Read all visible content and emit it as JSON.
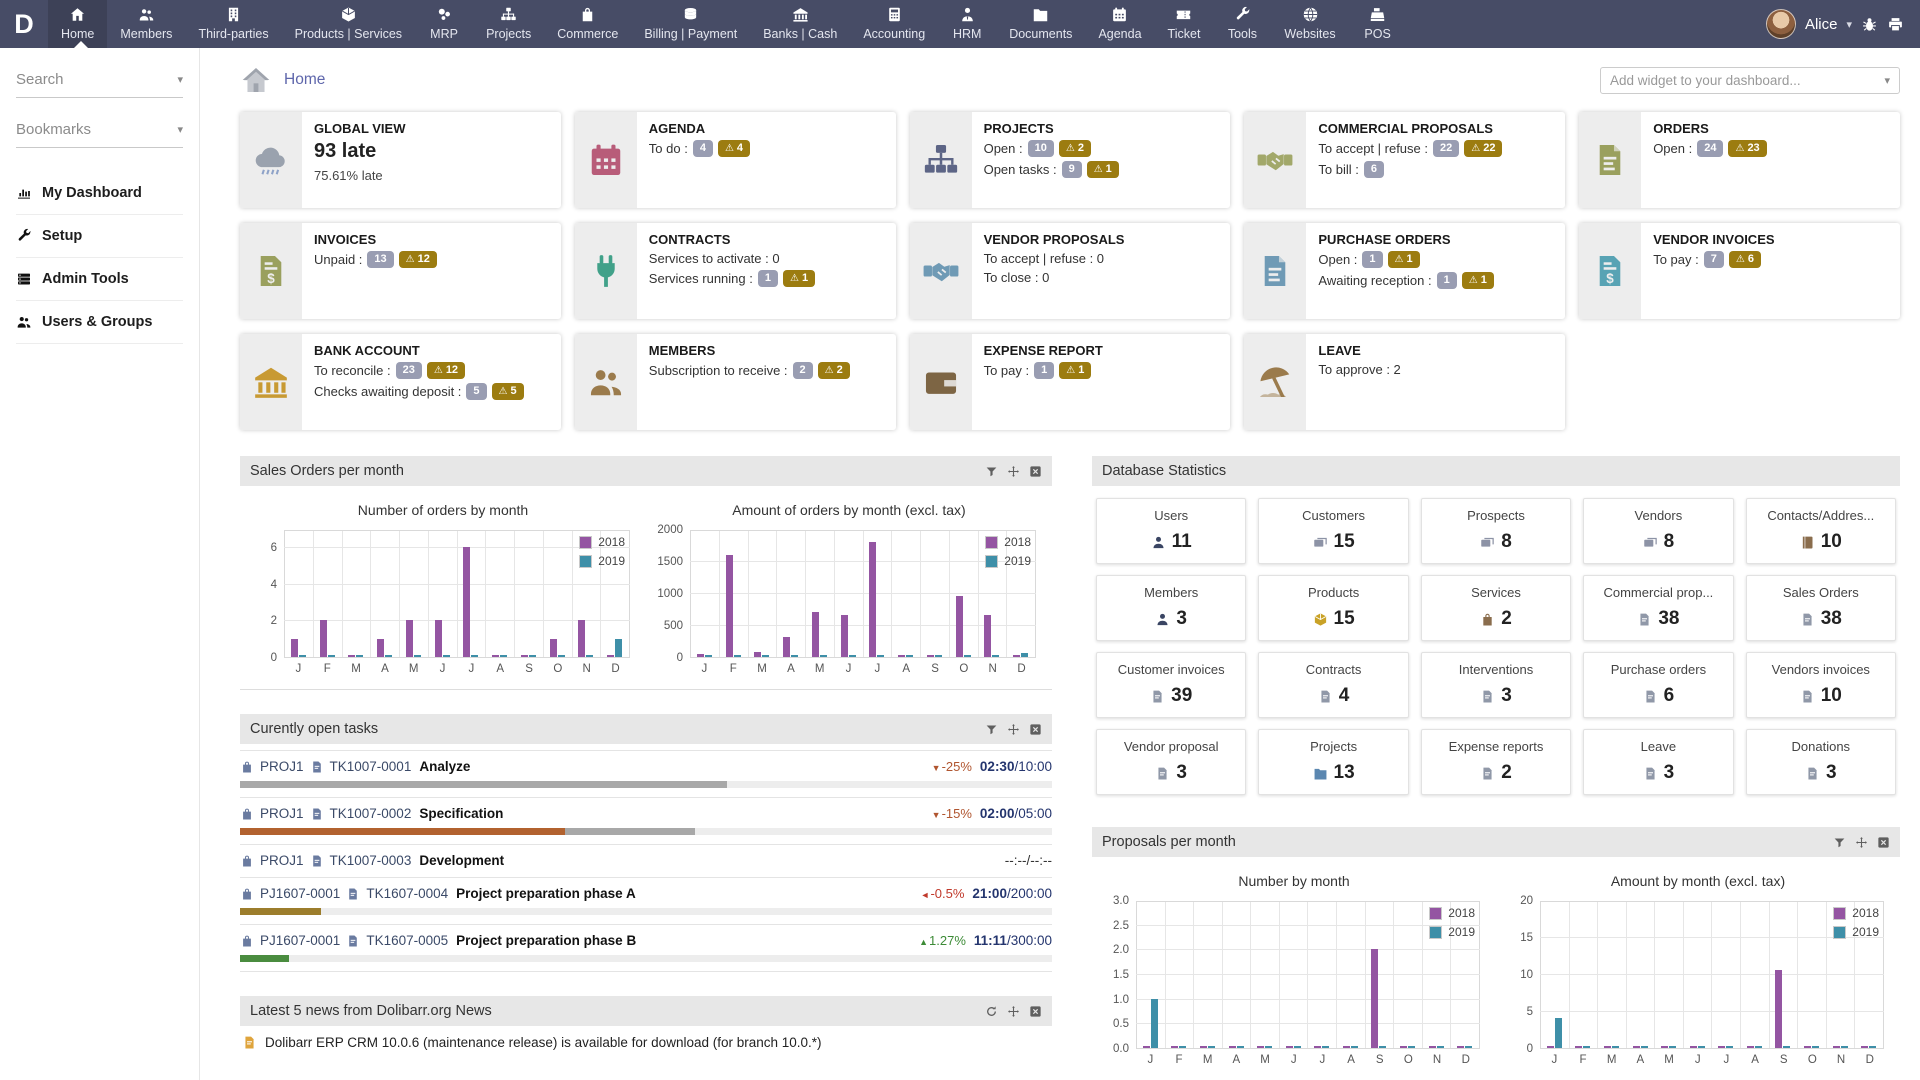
{
  "app": {
    "logo_letter": "D"
  },
  "theme": {
    "nav_bg": "#474c66",
    "badge_gray": "#999db2",
    "badge_warn": "#9c7c10",
    "link": "#5e66ab",
    "bar_2018": "#9455a2",
    "bar_2019": "#3e8fa8"
  },
  "nav": {
    "user_name": "Alice",
    "items": [
      {
        "label": "Home",
        "icon": "home-icon",
        "active": true
      },
      {
        "label": "Members",
        "icon": "members-icon"
      },
      {
        "label": "Third-parties",
        "icon": "third-parties-icon"
      },
      {
        "label": "Products | Services",
        "icon": "products-icon"
      },
      {
        "label": "MRP",
        "icon": "mrp-icon"
      },
      {
        "label": "Projects",
        "icon": "projects-icon"
      },
      {
        "label": "Commerce",
        "icon": "commerce-icon"
      },
      {
        "label": "Billing | Payment",
        "icon": "billing-icon"
      },
      {
        "label": "Banks | Cash",
        "icon": "banks-icon"
      },
      {
        "label": "Accounting",
        "icon": "accounting-icon"
      },
      {
        "label": "HRM",
        "icon": "hrm-icon"
      },
      {
        "label": "Documents",
        "icon": "documents-icon"
      },
      {
        "label": "Agenda",
        "icon": "agenda-icon"
      },
      {
        "label": "Ticket",
        "icon": "ticket-icon"
      },
      {
        "label": "Tools",
        "icon": "tools-icon"
      },
      {
        "label": "Websites",
        "icon": "websites-icon"
      },
      {
        "label": "POS",
        "icon": "pos-icon"
      }
    ]
  },
  "sidebar": {
    "search_label": "Search",
    "bookmarks_label": "Bookmarks",
    "items": [
      {
        "label": "My Dashboard",
        "icon": "dashboard-icon"
      },
      {
        "label": "Setup",
        "icon": "setup-icon"
      },
      {
        "label": "Admin Tools",
        "icon": "admin-tools-icon"
      },
      {
        "label": "Users & Groups",
        "icon": "users-groups-icon"
      }
    ]
  },
  "header": {
    "breadcrumb": "Home",
    "add_widget_placeholder": "Add widget to your dashboard..."
  },
  "widgets": [
    {
      "title": "GLOBAL VIEW",
      "icon": "storm-icon",
      "icon_color": "#97a0ad",
      "big": "93 late",
      "sub": "75.61% late",
      "lines": []
    },
    {
      "title": "AGENDA",
      "icon": "agenda-icon",
      "icon_color": "#b85c79",
      "lines": [
        {
          "label": "To do :",
          "badges": [
            {
              "v": "4"
            },
            {
              "v": "4",
              "warn": true
            }
          ]
        }
      ]
    },
    {
      "title": "PROJECTS",
      "icon": "projects-icon",
      "icon_color": "#5d6586",
      "lines": [
        {
          "label": "Open :",
          "badges": [
            {
              "v": "10"
            },
            {
              "v": "2",
              "warn": true
            }
          ]
        },
        {
          "label": "Open tasks :",
          "badges": [
            {
              "v": "9"
            },
            {
              "v": "1",
              "warn": true
            }
          ]
        }
      ]
    },
    {
      "title": "COMMERCIAL PROPOSALS",
      "icon": "handshake-icon",
      "icon_color": "#a2a86a",
      "lines": [
        {
          "label": "To accept | refuse :",
          "badges": [
            {
              "v": "22"
            },
            {
              "v": "22",
              "warn": true
            }
          ]
        },
        {
          "label": "To bill :",
          "badges": [
            {
              "v": "6"
            }
          ]
        }
      ]
    },
    {
      "title": "ORDERS",
      "icon": "order-doc-icon",
      "icon_color": "#9aa05e",
      "lines": [
        {
          "label": "Open :",
          "badges": [
            {
              "v": "24"
            },
            {
              "v": "23",
              "warn": true
            }
          ]
        }
      ]
    },
    {
      "title": "INVOICES",
      "icon": "invoice-dollar-icon",
      "icon_color": "#9aa05e",
      "lines": [
        {
          "label": "Unpaid :",
          "badges": [
            {
              "v": "13"
            },
            {
              "v": "12",
              "warn": true
            }
          ]
        }
      ]
    },
    {
      "title": "CONTRACTS",
      "icon": "plug-icon",
      "icon_color": "#41a189",
      "lines": [
        {
          "label": "Services to activate : 0",
          "badges": []
        },
        {
          "label": "Services running :",
          "badges": [
            {
              "v": "1"
            },
            {
              "v": "1",
              "warn": true
            }
          ]
        }
      ]
    },
    {
      "title": "VENDOR PROPOSALS",
      "icon": "handshake-icon",
      "icon_color": "#6f9ab5",
      "lines": [
        {
          "label": "To accept | refuse : 0",
          "badges": []
        },
        {
          "label": "To close : 0",
          "badges": []
        }
      ]
    },
    {
      "title": "PURCHASE ORDERS",
      "icon": "purchase-doc-icon",
      "icon_color": "#6f9ab5",
      "lines": [
        {
          "label": "Open :",
          "badges": [
            {
              "v": "1"
            },
            {
              "v": "1",
              "warn": true
            }
          ]
        },
        {
          "label": "Awaiting reception :",
          "badges": [
            {
              "v": "1"
            },
            {
              "v": "1",
              "warn": true
            }
          ]
        }
      ]
    },
    {
      "title": "VENDOR INVOICES",
      "icon": "invoice-dollar-icon",
      "icon_color": "#58a3b4",
      "lines": [
        {
          "label": "To pay :",
          "badges": [
            {
              "v": "7"
            },
            {
              "v": "6",
              "warn": true
            }
          ]
        }
      ]
    },
    {
      "title": "BANK ACCOUNT",
      "icon": "bank-icon",
      "icon_color": "#c89a33",
      "lines": [
        {
          "label": "To reconcile :",
          "badges": [
            {
              "v": "23"
            },
            {
              "v": "12",
              "warn": true
            }
          ]
        },
        {
          "label": "Checks awaiting deposit :",
          "badges": [
            {
              "v": "5"
            },
            {
              "v": "5",
              "warn": true
            }
          ]
        }
      ]
    },
    {
      "title": "MEMBERS",
      "icon": "members-group-icon",
      "icon_color": "#9b7b4c",
      "lines": [
        {
          "label": "Subscription to receive :",
          "badges": [
            {
              "v": "2"
            },
            {
              "v": "2",
              "warn": true
            }
          ]
        }
      ]
    },
    {
      "title": "EXPENSE REPORT",
      "icon": "wallet-icon",
      "icon_color": "#7d6544",
      "lines": [
        {
          "label": "To pay :",
          "badges": [
            {
              "v": "1"
            },
            {
              "v": "1",
              "warn": true
            }
          ]
        }
      ]
    },
    {
      "title": "LEAVE",
      "icon": "umbrella-icon",
      "icon_color": "#9b7b4c",
      "lines": [
        {
          "label": "To approve : 2",
          "badges": []
        }
      ]
    }
  ],
  "sections": {
    "sales": {
      "title": "Sales Orders per month"
    },
    "tasks": {
      "title": "Curently open tasks"
    },
    "news": {
      "title": "Latest 5 news from Dolibarr.org News"
    },
    "stats": {
      "title": "Database Statistics"
    },
    "proposals": {
      "title": "Proposals per month"
    }
  },
  "chart_data": [
    {
      "id": "sales-number",
      "type": "bar",
      "title": "Number of orders by month",
      "categories": [
        "J",
        "F",
        "M",
        "A",
        "M",
        "J",
        "J",
        "A",
        "S",
        "O",
        "N",
        "D"
      ],
      "ylim": [
        0,
        7
      ],
      "ymax": 7,
      "grid": true,
      "legend_position": "top-right",
      "yticks": [
        {
          "v": 0,
          "label": "0"
        },
        {
          "v": 2,
          "label": "2"
        },
        {
          "v": 4,
          "label": "4"
        },
        {
          "v": 6,
          "label": "6"
        }
      ],
      "series": [
        {
          "name": "2018",
          "color": "#9455a2",
          "values": [
            1,
            2,
            0,
            1,
            2,
            2,
            6,
            0,
            0,
            1,
            2,
            0
          ]
        },
        {
          "name": "2019",
          "color": "#3e8fa8",
          "values": [
            0,
            0,
            0,
            0,
            0,
            0,
            0,
            0,
            0,
            0,
            0,
            1
          ]
        }
      ]
    },
    {
      "id": "sales-amount",
      "type": "bar",
      "title": "Amount of orders by month (excl. tax)",
      "categories": [
        "J",
        "F",
        "M",
        "A",
        "M",
        "J",
        "J",
        "A",
        "S",
        "O",
        "N",
        "D"
      ],
      "ylim": [
        0,
        2000
      ],
      "ymax": 2000,
      "grid": true,
      "legend_position": "top-right",
      "yticks": [
        {
          "v": 0,
          "label": "0"
        },
        {
          "v": 500,
          "label": "500"
        },
        {
          "v": 1000,
          "label": "1000"
        },
        {
          "v": 1500,
          "label": "1500"
        },
        {
          "v": 2000,
          "label": "2000"
        }
      ],
      "series": [
        {
          "name": "2018",
          "color": "#9455a2",
          "values": [
            50,
            1600,
            80,
            320,
            700,
            650,
            1800,
            30,
            30,
            950,
            650,
            30
          ]
        },
        {
          "name": "2019",
          "color": "#3e8fa8",
          "values": [
            0,
            0,
            0,
            0,
            0,
            0,
            0,
            0,
            0,
            0,
            0,
            60
          ]
        }
      ]
    },
    {
      "id": "proposals-number",
      "type": "bar",
      "title": "Number by month",
      "categories": [
        "J",
        "F",
        "M",
        "A",
        "M",
        "J",
        "J",
        "A",
        "S",
        "O",
        "N",
        "D"
      ],
      "ylim": [
        0,
        3
      ],
      "ymax": 3,
      "grid": true,
      "legend_position": "top-right",
      "yticks": [
        {
          "v": 0,
          "label": "0.0"
        },
        {
          "v": 0.5,
          "label": "0.5"
        },
        {
          "v": 1,
          "label": "1.0"
        },
        {
          "v": 1.5,
          "label": "1.5"
        },
        {
          "v": 2,
          "label": "2.0"
        },
        {
          "v": 2.5,
          "label": "2.5"
        },
        {
          "v": 3,
          "label": "3.0"
        }
      ],
      "series": [
        {
          "name": "2018",
          "color": "#9455a2",
          "values": [
            0,
            0,
            0,
            0,
            0,
            0,
            0,
            0,
            2,
            0,
            0,
            0
          ]
        },
        {
          "name": "2019",
          "color": "#3e8fa8",
          "values": [
            1,
            0,
            0,
            0,
            0,
            0,
            0,
            0,
            0,
            0,
            0,
            0
          ]
        }
      ]
    },
    {
      "id": "proposals-amount",
      "type": "bar",
      "title": "Amount by month (excl. tax)",
      "categories": [
        "J",
        "F",
        "M",
        "A",
        "M",
        "J",
        "J",
        "A",
        "S",
        "O",
        "N",
        "D"
      ],
      "ylim": [
        0,
        20
      ],
      "ymax": 20,
      "grid": true,
      "legend_position": "top-right",
      "yticks": [
        {
          "v": 0,
          "label": "0"
        },
        {
          "v": 5,
          "label": "5"
        },
        {
          "v": 10,
          "label": "10"
        },
        {
          "v": 15,
          "label": "15"
        },
        {
          "v": 20,
          "label": "20"
        }
      ],
      "series": [
        {
          "name": "2018",
          "color": "#9455a2",
          "values": [
            0,
            0,
            0,
            0,
            0,
            0,
            0,
            0,
            10.5,
            0,
            0,
            0
          ]
        },
        {
          "name": "2019",
          "color": "#3e8fa8",
          "values": [
            4,
            0,
            0,
            0,
            0,
            0,
            0,
            0,
            0,
            0,
            0,
            0
          ]
        }
      ]
    }
  ],
  "tasks": [
    {
      "project": "PROJ1",
      "ref": "TK1007-0001",
      "name": "Analyze",
      "delta": "-25%",
      "delta_dir": "down",
      "delta_color": "#b0552f",
      "time": "02:30",
      "total": "/10:00",
      "bar": [
        {
          "c": "#a8a8a8",
          "w": 60
        }
      ]
    },
    {
      "project": "PROJ1",
      "ref": "TK1007-0002",
      "name": "Specification",
      "delta": "-15%",
      "delta_dir": "down",
      "delta_color": "#b0552f",
      "time": "02:00",
      "total": "/05:00",
      "bar": [
        {
          "c": "#b2622f",
          "w": 40
        },
        {
          "c": "#a8a8a8",
          "w": 16
        }
      ]
    },
    {
      "project": "PROJ1",
      "ref": "TK1007-0003",
      "name": "Development",
      "time_na": "--:--/--:--"
    },
    {
      "project": "PJ1607-0001",
      "ref": "TK1607-0004",
      "name": "Project preparation phase A",
      "delta": "-0.5%",
      "delta_dir": "left",
      "delta_color": "#c0392b",
      "time": "21:00",
      "total": "/200:00",
      "bar": [
        {
          "c": "#9c7d2c",
          "w": 10
        }
      ]
    },
    {
      "project": "PJ1607-0001",
      "ref": "TK1607-0005",
      "name": "Project preparation phase B",
      "delta": "1.27%",
      "delta_dir": "up",
      "delta_color": "#3d8b37",
      "time": "11:11",
      "total": "/300:00",
      "bar": [
        {
          "c": "#4a8c3f",
          "w": 6
        }
      ]
    }
  ],
  "news_items": [
    {
      "title": "Dolibarr ERP CRM 10.0.6 (maintenance release) is available for download (for branch 10.0.*)"
    }
  ],
  "stats_cards": [
    {
      "label": "Users",
      "value": "11",
      "icon": "person-icon",
      "icon_color": "#3a4563"
    },
    {
      "label": "Customers",
      "value": "15",
      "icon": "cards-icon",
      "icon_color": "#8d93a6"
    },
    {
      "label": "Prospects",
      "value": "8",
      "icon": "cards-icon",
      "icon_color": "#8d93a6"
    },
    {
      "label": "Vendors",
      "value": "8",
      "icon": "cards-icon",
      "icon_color": "#8d93a6"
    },
    {
      "label": "Contacts/Addres...",
      "value": "10",
      "icon": "book-icon",
      "icon_color": "#8a6d4d"
    },
    {
      "label": "Members",
      "value": "3",
      "icon": "person-icon",
      "icon_color": "#3a4563"
    },
    {
      "label": "Products",
      "value": "15",
      "icon": "box-icon",
      "icon_color": "#c9a227"
    },
    {
      "label": "Services",
      "value": "2",
      "icon": "briefcase-icon",
      "icon_color": "#8a6d4d"
    },
    {
      "label": "Commercial prop...",
      "value": "38",
      "icon": "doc-icon",
      "icon_color": "#9098a8"
    },
    {
      "label": "Sales Orders",
      "value": "38",
      "icon": "doc-icon",
      "icon_color": "#9098a8"
    },
    {
      "label": "Customer invoices",
      "value": "39",
      "icon": "doc-icon",
      "icon_color": "#9098a8"
    },
    {
      "label": "Contracts",
      "value": "4",
      "icon": "doc-icon",
      "icon_color": "#9098a8"
    },
    {
      "label": "Interventions",
      "value": "3",
      "icon": "doc-icon",
      "icon_color": "#9098a8"
    },
    {
      "label": "Purchase orders",
      "value": "6",
      "icon": "doc-icon",
      "icon_color": "#9098a8"
    },
    {
      "label": "Vendors invoices",
      "value": "10",
      "icon": "doc-icon",
      "icon_color": "#9098a8"
    },
    {
      "label": "Vendor proposal",
      "value": "3",
      "icon": "doc-icon",
      "icon_color": "#9098a8"
    },
    {
      "label": "Projects",
      "value": "13",
      "icon": "folder-icon",
      "icon_color": "#5b87b0"
    },
    {
      "label": "Expense reports",
      "value": "2",
      "icon": "doc-icon",
      "icon_color": "#9098a8"
    },
    {
      "label": "Leave",
      "value": "3",
      "icon": "doc-icon",
      "icon_color": "#9098a8"
    },
    {
      "label": "Donations",
      "value": "3",
      "icon": "doc-icon",
      "icon_color": "#9098a8"
    }
  ]
}
